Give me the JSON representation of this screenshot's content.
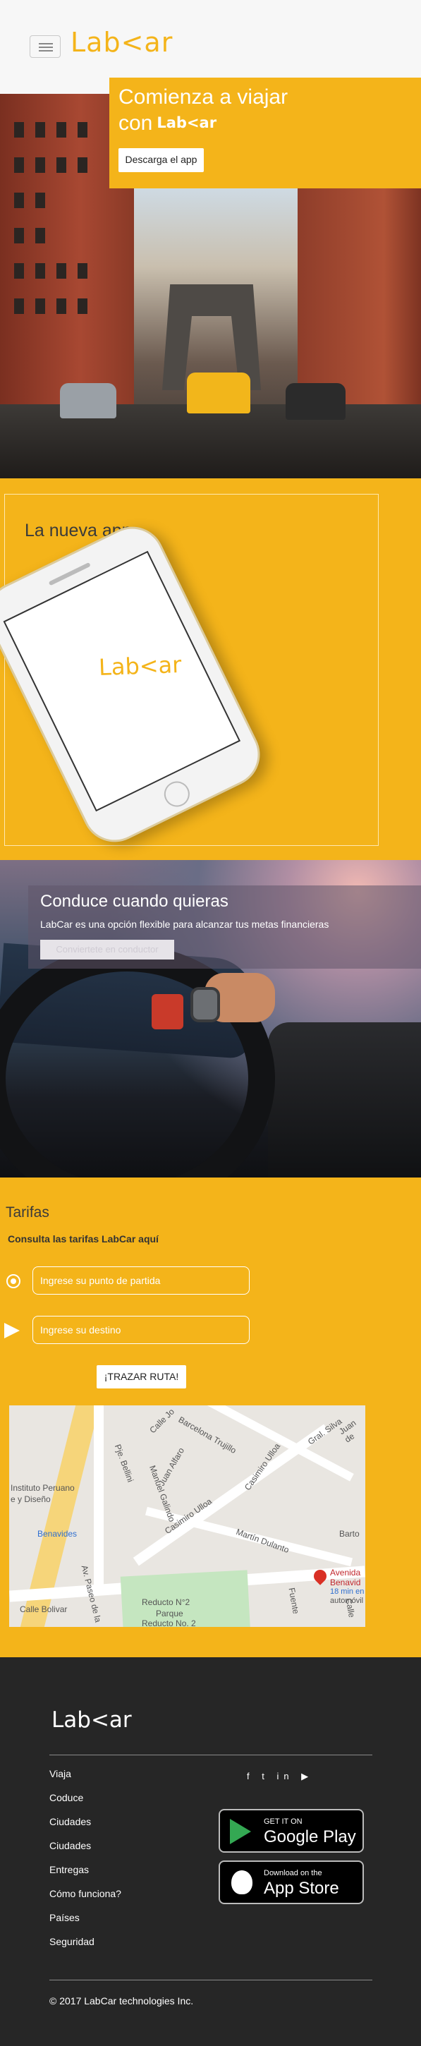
{
  "header": {
    "logo_text": "Lab<ar",
    "menu_icon": "hamburger-menu-icon"
  },
  "hero": {
    "title_line1": "Comienza a viajar",
    "title_line2": "con",
    "title_brand": "Lab<ar",
    "download_label": "Descarga el app"
  },
  "app": {
    "title": "La nueva app",
    "phone_logo": "Lab<ar"
  },
  "drive": {
    "title": "Conduce cuando quieras",
    "subtitle": "LabCar es una opción flexible para alcanzar tus metas financieras",
    "cta_label": "Conviertete en conductor"
  },
  "tarifas": {
    "title": "Tarifas",
    "subtitle": "Consulta las tarifas LabCar aquí",
    "origin_placeholder": "Ingrese su punto de partida",
    "destination_placeholder": "Ingrese su destino",
    "route_label": "¡TRAZAR RUTA!",
    "icons": [
      "origin-pin-icon",
      "send-arrow-icon"
    ]
  },
  "map": {
    "labels": [
      "Calle Jo",
      "Barcelona Trujillo",
      "Gral. Silva",
      "Juan de",
      "Pje. Bellini",
      "Juan Alfaro",
      "Instituto Peruano",
      "e y Diseño",
      "Manuel Galindo",
      "Casimiro Ulloa",
      "Benavides",
      "Casimiro Ulloa",
      "Martín Dulanto",
      "Barto",
      "Av. Paseo de la",
      "Calle Bolivar",
      "Reducto N°2",
      "Parque",
      "Reducto No. 2",
      "Fuente",
      "Calle"
    ],
    "destination_label_1": "Avenida",
    "destination_label_2": "Benavid",
    "destination_eta": "18 min en",
    "destination_mode": "automóvil"
  },
  "footer": {
    "logo_text": "Lab<ar",
    "links": [
      "Viaja",
      "Coduce",
      "Ciudades",
      "Ciudades",
      "Entregas",
      "Cómo funciona?",
      "Países",
      "Seguridad"
    ],
    "social_icons": "f  t  in    ▶",
    "google_small": "GET IT ON",
    "google_big": "Google Play",
    "apple_small": "Download on the",
    "apple_big": "App Store",
    "copyright": "© 2017 LabCar technologies Inc."
  },
  "colors": {
    "brand_yellow": "#f4b41a",
    "footer_bg": "#262626"
  }
}
